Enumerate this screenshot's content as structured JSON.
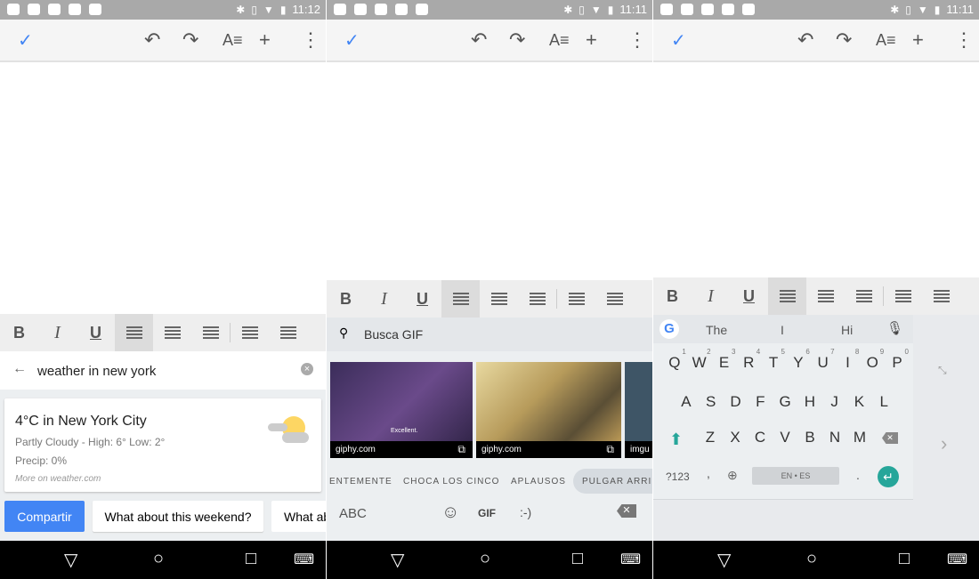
{
  "panels": [
    {
      "time": "11:12"
    },
    {
      "time": "11:11"
    },
    {
      "time": "11:11"
    }
  ],
  "format_bar": {
    "bold": "B",
    "italic": "I",
    "underline": "U"
  },
  "assistant": {
    "query": "weather in new york",
    "card": {
      "title": "4°C in New York City",
      "condition": "Partly Cloudy - High: 6° Low: 2°",
      "precip": "Precip: 0%",
      "source": "More on weather.com"
    },
    "chips": [
      "Compartir",
      "What about this weekend?",
      "What ab"
    ]
  },
  "gif": {
    "search_placeholder": "Busca GIF",
    "results": [
      {
        "source": "giphy.com",
        "caption": "Excellent."
      },
      {
        "source": "giphy.com",
        "caption": ""
      },
      {
        "source": "imgu",
        "caption": ""
      }
    ],
    "categories": [
      "ENTEMENTE",
      "CHOCA LOS CINCO",
      "APLAUSOS",
      "PULGAR ARRIBA"
    ],
    "bottom": {
      "abc": "ABC",
      "gif": "GIF",
      "emoticon": ":-)"
    }
  },
  "keyboard": {
    "suggestions": [
      "The",
      "I",
      "Hi"
    ],
    "row1": [
      "Q",
      "W",
      "E",
      "R",
      "T",
      "Y",
      "U",
      "I",
      "O",
      "P"
    ],
    "row1_hints": [
      "1",
      "2",
      "3",
      "4",
      "5",
      "6",
      "7",
      "8",
      "9",
      "0"
    ],
    "row2": [
      "A",
      "S",
      "D",
      "F",
      "G",
      "H",
      "J",
      "K",
      "L"
    ],
    "row3": [
      "Z",
      "X",
      "C",
      "V",
      "B",
      "N",
      "M"
    ],
    "symbols": "?123",
    "comma": ",",
    "space": "EN • ES",
    "period": "."
  },
  "colors": {
    "accent": "#4285f4",
    "enter": "#26a69a",
    "status_bar": "#a9a9a9"
  }
}
